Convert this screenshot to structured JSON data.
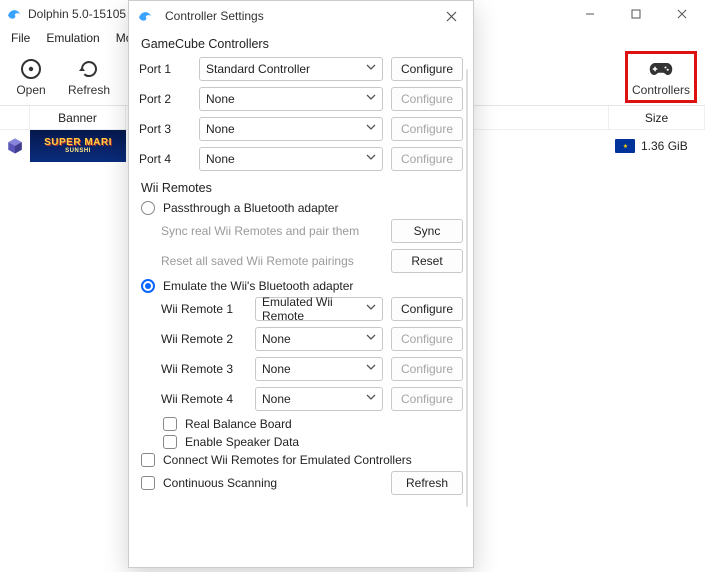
{
  "main": {
    "title": "Dolphin 5.0-15105",
    "menu": {
      "file": "File",
      "emulation": "Emulation",
      "movie_truncated": "Mo"
    },
    "toolbar": {
      "open": "Open",
      "refresh": "Refresh",
      "controllers": "Controllers"
    },
    "list_header": {
      "banner": "Banner",
      "size": "Size"
    },
    "game": {
      "banner_line1": "SUPER MARI",
      "banner_line2": "SUNSHI",
      "size": "1.36 GiB"
    }
  },
  "dialog": {
    "title": "Controller Settings",
    "gamecube": {
      "heading": "GameCube Controllers",
      "ports": [
        {
          "label": "Port 1",
          "value": "Standard Controller",
          "configure": "Configure",
          "enabled": true
        },
        {
          "label": "Port 2",
          "value": "None",
          "configure": "Configure",
          "enabled": false
        },
        {
          "label": "Port 3",
          "value": "None",
          "configure": "Configure",
          "enabled": false
        },
        {
          "label": "Port 4",
          "value": "None",
          "configure": "Configure",
          "enabled": false
        }
      ]
    },
    "wii": {
      "heading": "Wii Remotes",
      "passthrough_label": "Passthrough a Bluetooth adapter",
      "sync_text": "Sync real Wii Remotes and pair them",
      "sync_btn": "Sync",
      "reset_text": "Reset all saved Wii Remote pairings",
      "reset_btn": "Reset",
      "emulate_label": "Emulate the Wii's Bluetooth adapter",
      "remotes": [
        {
          "label": "Wii Remote 1",
          "value": "Emulated Wii Remote",
          "configure": "Configure",
          "enabled": true
        },
        {
          "label": "Wii Remote 2",
          "value": "None",
          "configure": "Configure",
          "enabled": false
        },
        {
          "label": "Wii Remote 3",
          "value": "None",
          "configure": "Configure",
          "enabled": false
        },
        {
          "label": "Wii Remote 4",
          "value": "None",
          "configure": "Configure",
          "enabled": false
        }
      ],
      "real_balance": "Real Balance Board",
      "speaker_data": "Enable Speaker Data",
      "connect_emulated": "Connect Wii Remotes for Emulated Controllers",
      "continuous": "Continuous Scanning",
      "refresh_btn": "Refresh"
    }
  }
}
